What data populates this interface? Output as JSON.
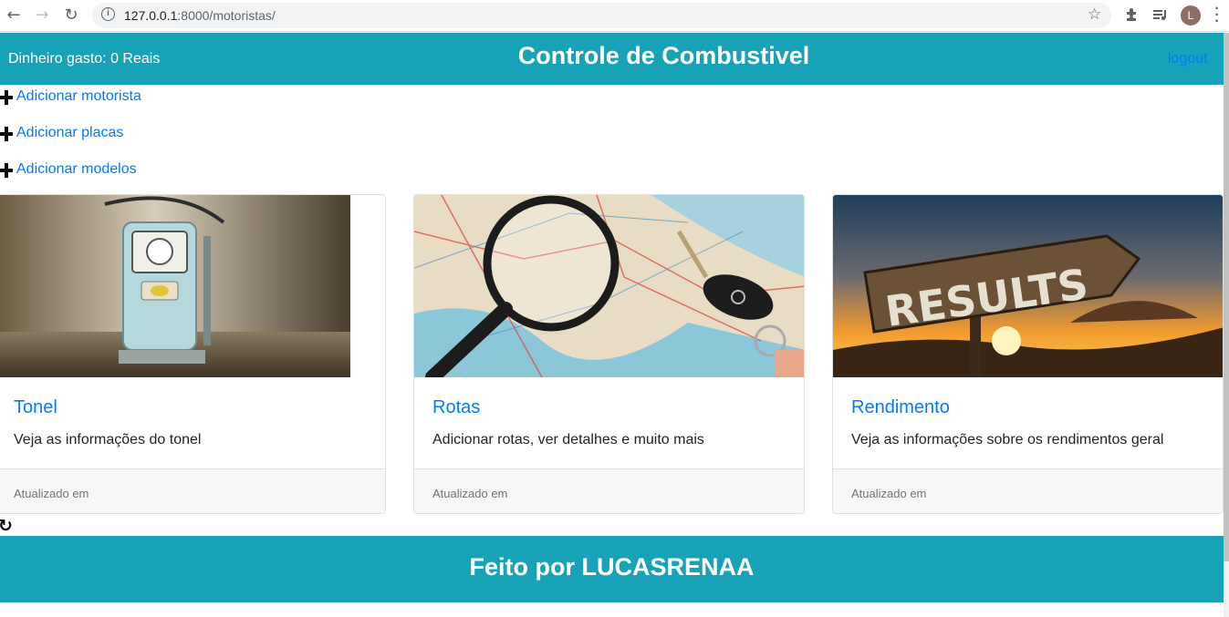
{
  "browser": {
    "url_host": "127.0.0.1",
    "url_rest": ":8000/motoristas/",
    "profile_initial": "L"
  },
  "header": {
    "money_spent": "Dinheiro gasto: 0 Reais",
    "title": "Controle de Combustivel",
    "logout": "logout",
    "bg_color": "#17a2b8"
  },
  "actions": [
    {
      "label": "Adicionar motorista",
      "icon": "plus-icon"
    },
    {
      "label": "Adicionar placas",
      "icon": "plus-icon"
    },
    {
      "label": "Adicionar modelos",
      "icon": "plus-icon"
    }
  ],
  "cards": [
    {
      "title": "Tonel",
      "text": "Veja as informações do tonel",
      "footer": "Atualizado em",
      "image": "fuel-pump-image"
    },
    {
      "title": "Rotas",
      "text": "Adicionar rotas, ver detalhes e muito mais",
      "footer": "Atualizado em",
      "image": "map-magnifier-image"
    },
    {
      "title": "Rendimento",
      "text": "Veja as informações sobre os rendimentos geral",
      "footer": "Atualizado em",
      "image": "results-sign-image",
      "image_text": "RESULTS"
    }
  ],
  "footer": {
    "text": "Feito por LUCASRENAA"
  }
}
